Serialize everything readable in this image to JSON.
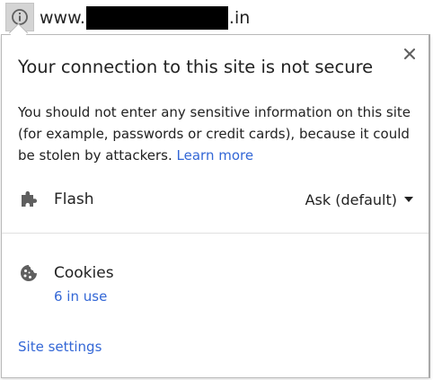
{
  "omnibox": {
    "url_prefix": "www.",
    "url_suffix": ".in",
    "info_icon": "info-circle-icon"
  },
  "popup": {
    "title": "Your connection to this site is not secure",
    "description": "You should not enter any sensitive information on this site (for example, passwords or credit cards), because it could be stolen by attackers. ",
    "learn_more": "Learn more",
    "close_icon": "close-icon",
    "permissions": {
      "flash": {
        "icon": "puzzle-piece-icon",
        "label": "Flash",
        "setting": "Ask (default)"
      },
      "cookies": {
        "icon": "cookie-icon",
        "label": "Cookies",
        "count": "6 in use"
      }
    },
    "site_settings": "Site settings"
  },
  "colors": {
    "link": "#3367d6",
    "text": "#222222",
    "icon_gray": "#5f5f5f"
  }
}
